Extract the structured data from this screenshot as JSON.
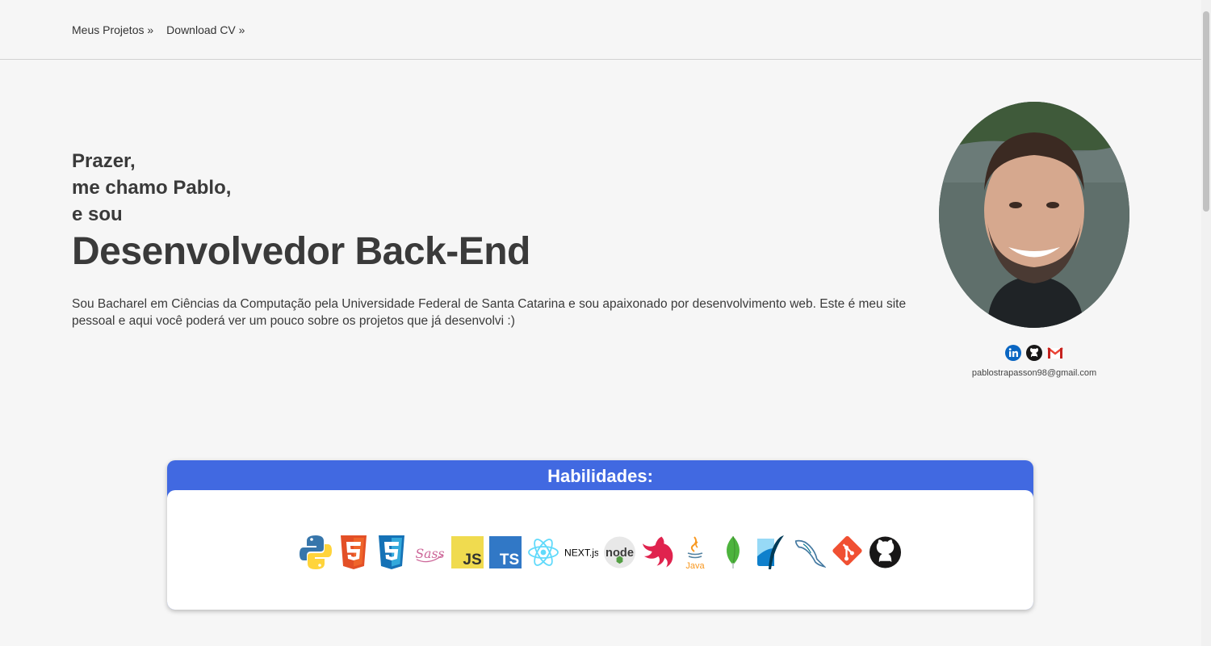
{
  "nav": {
    "projects_label": "Meus Projetos »",
    "cv_label": "Download CV »"
  },
  "hero": {
    "line1": "Prazer,",
    "line2": "me chamo Pablo,",
    "line3": "e sou",
    "role": "Desenvolvedor Back-End",
    "description": "Sou Bacharel em Ciências da Computação pela Universidade Federal de Santa Catarina e sou apaixonado por desenvolvimento web. Este é meu site pessoal e aqui você poderá ver um pouco sobre os projetos que já desenvolvi :)"
  },
  "profile": {
    "email": "pablostrapasson98@gmail.com",
    "social": [
      "linkedin-icon",
      "github-icon",
      "gmail-icon"
    ]
  },
  "skills": {
    "title": "Habilidades:",
    "icons": [
      "python-icon",
      "html5-icon",
      "css3-icon",
      "sass-icon",
      "javascript-icon",
      "typescript-icon",
      "react-icon",
      "nextjs-icon",
      "nodejs-icon",
      "nestjs-icon",
      "java-icon",
      "mongodb-icon",
      "sqlite-icon",
      "mysql-icon",
      "git-icon",
      "github-icon"
    ],
    "labels": {
      "js": "JS",
      "ts": "TS",
      "next": "NEXT.js",
      "node": "node",
      "java": "Java",
      "sass": "Sass"
    }
  },
  "colors": {
    "accent": "#4169e1",
    "background": "#f6f6f6",
    "text": "#3a3a3a"
  }
}
